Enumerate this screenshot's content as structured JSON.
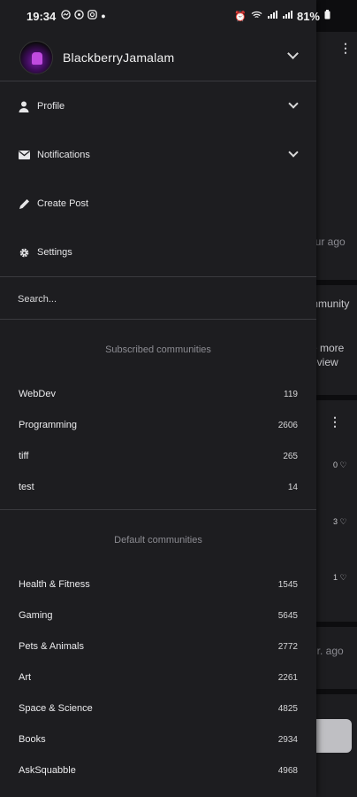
{
  "status_bar": {
    "time": "19:34",
    "left_icons": [
      "messenger-icon",
      "whatsapp-icon",
      "instagram-icon",
      "dot-icon"
    ],
    "battery": "81%"
  },
  "account": {
    "username": "BlackberryJamalam"
  },
  "menu": [
    {
      "label": "Profile",
      "icon": "person-icon",
      "expandable": true
    },
    {
      "label": "Notifications",
      "icon": "mail-icon",
      "expandable": true
    },
    {
      "label": "Create Post",
      "icon": "pencil-icon",
      "expandable": false
    },
    {
      "label": "Settings",
      "icon": "gear-icon",
      "expandable": false
    }
  ],
  "search": {
    "placeholder": "Search..."
  },
  "subscribed": {
    "heading": "Subscribed communities",
    "items": [
      {
        "name": "WebDev",
        "count": "119"
      },
      {
        "name": "Programming",
        "count": "2606"
      },
      {
        "name": "tiff",
        "count": "265"
      },
      {
        "name": "test",
        "count": "14"
      }
    ]
  },
  "default": {
    "heading": "Default communities",
    "items": [
      {
        "name": "Health & Fitness",
        "count": "1545"
      },
      {
        "name": "Gaming",
        "count": "5645"
      },
      {
        "name": "Pets & Animals",
        "count": "2772"
      },
      {
        "name": "Art",
        "count": "2261"
      },
      {
        "name": "Space & Science",
        "count": "4825"
      },
      {
        "name": "Books",
        "count": "2934"
      },
      {
        "name": "AskSquabble",
        "count": "4968"
      }
    ]
  },
  "background": {
    "texts": [
      "our ago",
      "mmunity",
      "e more",
      "eview",
      "0",
      "3",
      "1",
      "hr. ago"
    ]
  },
  "colors": {
    "drawer_bg": "#1d1d20",
    "backdrop": "#0d0d0f",
    "divider": "#3a3a3e",
    "avatar_accent": "#7a1fa8"
  }
}
